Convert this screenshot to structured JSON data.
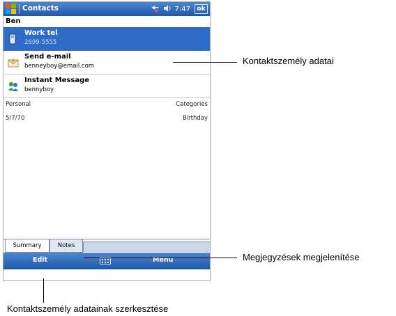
{
  "titlebar": {
    "app_title": "Contacts",
    "time": "7:47",
    "ok_label": "ok",
    "icons": [
      "windows-start-icon",
      "connectivity-icon",
      "speaker-icon"
    ]
  },
  "contact": {
    "name": "Ben"
  },
  "details": [
    {
      "title": "Work tel",
      "value": "2699-5555",
      "icon": "phone-icon",
      "selected": true
    },
    {
      "title": "Send e-mail",
      "value": "benneyboy@email.com",
      "icon": "envelope-icon",
      "selected": false
    },
    {
      "title": "Instant Message",
      "value": "bennyboy",
      "icon": "messenger-icon",
      "selected": false
    }
  ],
  "info_rows": [
    {
      "left": "Personal",
      "right": "Categories"
    },
    {
      "left": "5/7/70",
      "right": "Birthday"
    }
  ],
  "tabs": {
    "summary": "Summary",
    "notes": "Notes",
    "active": "Summary"
  },
  "menubar": {
    "left": "Edit",
    "right": "Menu",
    "center_icon": "keyboard-icon"
  },
  "callouts": {
    "details": "Kontaktszemély adatai",
    "notes": "Megjegyzések megjelenítése",
    "edit": "Kontaktszemély adatainak szerkesztése"
  },
  "colors": {
    "titlebar": "#1d57a8",
    "selection": "#2f6cc7",
    "inactive_tab": "#dfe7f3"
  }
}
